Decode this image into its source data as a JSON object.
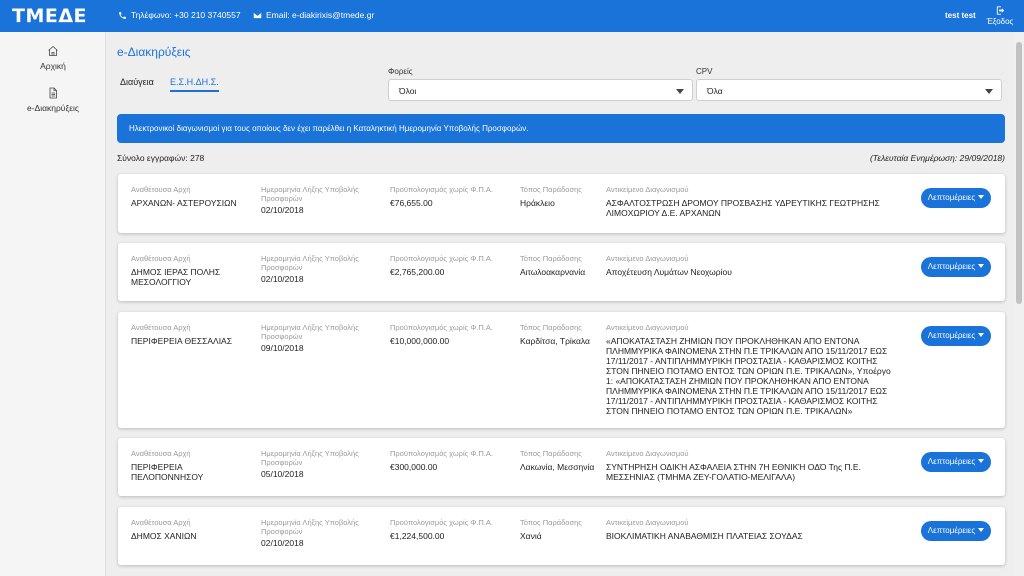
{
  "header": {
    "logo": "ΤΜΕΔΕ",
    "phone": "Τηλέφωνο: +30 210 3740557",
    "email": "Email: e-diakirixis@tmede.gr",
    "user": "test test",
    "exit_label": "Έξοδος"
  },
  "sidebar": {
    "items": [
      {
        "label": "Αρχική",
        "icon": "home-icon"
      },
      {
        "label": "e-Διακηρύξεις",
        "icon": "document-icon"
      }
    ]
  },
  "main": {
    "title": "e-Διακηρύξεις",
    "tabs": [
      {
        "label": "Διαύγεια",
        "active": false
      },
      {
        "label": "Ε.Σ.Η.ΔΗ.Σ.",
        "active": true
      }
    ],
    "filters": {
      "foreis": {
        "label": "Φορείς",
        "value": "Όλοι"
      },
      "cpv": {
        "label": "CPV",
        "value": "Όλα"
      }
    },
    "banner": "Ηλεκτρονικοί διαγωνισμοί για τους οποίους δεν έχει παρέλθει η Καταληκτική Ημερομηνία Υποβολής Προσφορών.",
    "total": "Σύνολο εγγραφών: 278",
    "last_update": "(Τελευταία Ενημέρωση: 29/09/2018)",
    "column_labels": {
      "authority": "Αναθέτουσα Αρχή",
      "deadline": "Ημερομηνία Λήξης Υποβολής Προσφορών",
      "budget": "Προϋπολογισμός χωρίς Φ.Π.Α.",
      "place": "Τόπος Παράδοσης",
      "subject": "Αντικείμενο Διαγωνισμού"
    },
    "details_label": "Λεπτομέρειες",
    "tenders": [
      {
        "authority": "ΑΡΧΑΝΩΝ- ΑΣΤΕΡΟΥΣΙΩΝ",
        "deadline": "02/10/2018",
        "budget": "€76,655.00",
        "place": "Ηράκλειο",
        "subject": "ΑΣΦΑΛΤΟΣΤΡΩΣΗ ΔΡΟΜΟΥ ΠΡΟΣΒΑΣΗΣ ΥΔΡΕΥΤΙΚΗΣ ΓΕΩΤΡΗΣΗΣ ΛΙΜΟΧΩΡΙΟΥ Δ.Ε. ΑΡΧΑΝΩΝ"
      },
      {
        "authority": "ΔΗΜΟΣ ΙΕΡΑΣ ΠΟΛΗΣ ΜΕΣΟΛΟΓΓΙΟΥ",
        "deadline": "02/10/2018",
        "budget": "€2,765,200.00",
        "place": "Αιτωλοακαρνανία",
        "subject": "Αποχέτευση Λυμάτων Νεοχωρίου"
      },
      {
        "authority": "ΠΕΡΙΦΕΡΕΙΑ ΘΕΣΣΑΛΙΑΣ",
        "deadline": "09/10/2018",
        "budget": "€10,000,000.00",
        "place": "Καρδίτσα, Τρίκαλα",
        "subject": "«ΑΠΟΚΑΤΑΣΤΑΣΗ ΖΗΜΙΩΝ ΠΟΥ ΠΡΟΚΛΗΘΗΚΑΝ ΑΠΟ ΕΝΤΟΝΑ ΠΛΗΜΜΥΡΙΚΑ ΦΑΙΝΟΜΕΝΑ ΣΤΗΝ Π.Ε ΤΡΙΚΑΛΩΝ ΑΠΟ 15/11/2017 ΕΩΣ 17/11/2017 - ΑΝΤΙΠΛΗΜΜΥΡΙΚΗ ΠΡΟΣΤΑΣΙΑ - ΚΑΘΑΡΙΣΜΟΣ ΚΟΙΤΗΣ ΣΤΟΝ ΠΗΝΕΙΟ ΠΟΤΑΜΟ ΕΝΤΟΣ ΤΩΝ ΟΡΙΩΝ Π.Ε. ΤΡΙΚΑΛΩΝ», Υποέργο 1: «ΑΠΟΚΑΤΑΣΤΑΣΗ ΖΗΜΙΩΝ ΠΟΥ ΠΡΟΚΛΗΘΗΚΑΝ ΑΠΟ ΕΝΤΟΝΑ ΠΛΗΜΜΥΡΙΚΑ ΦΑΙΝΟΜΕΝΑ ΣΤΗΝ Π.Ε ΤΡΙΚΑΛΩΝ ΑΠΟ 15/11/2017 ΕΩΣ 17/11/2017 - ΑΝΤΙΠΛΗΜΜΥΡΙΚΗ ΠΡΟΣΤΑΣΙΑ - ΚΑΘΑΡΙΣΜΟΣ ΚΟΙΤΗΣ ΣΤΟΝ ΠΗΝΕΙΟ ΠΟΤΑΜΟ ΕΝΤΟΣ ΤΩΝ ΟΡΙΩΝ Π.Ε. ΤΡΙΚΑΛΩΝ»"
      },
      {
        "authority": "ΠΕΡΙΦΕΡΕΙΑ ΠΕΛΟΠΟΝΝΗΣΟΥ",
        "deadline": "05/10/2018",
        "budget": "€300,000.00",
        "place": "Λακωνία, Μεσσηνία",
        "subject": "ΣΥΝΤΗΡΗΣΗ ΟΔΙΚΉ ΑΣΦΑΛΕΙΑ ΣΤΗΝ 7Η ΕΘΝΙΚΉ ΟΔΌ Της Π.Ε. ΜΕΣΣΗΝΙΑΣ (ΤΜΗΜΑ ΖΕΥ-ΓΟΛΑΤΙΟ-ΜΕΛΙΓΑΛΑ)"
      },
      {
        "authority": "ΔΗΜΟΣ ΧΑΝΙΩΝ",
        "deadline": "02/10/2018",
        "budget": "€1,224,500.00",
        "place": "Χανιά",
        "subject": "ΒΙΟΚΛΙΜΑΤΙΚΗ ΑΝΑΒΑΘΜΙΣΗ ΠΛΑΤΕΙΑΣ ΣΟΥΔΑΣ"
      }
    ]
  },
  "colors": {
    "primary": "#1a73d9",
    "background": "#eeeeee",
    "label_gray": "#9a9a9a"
  }
}
